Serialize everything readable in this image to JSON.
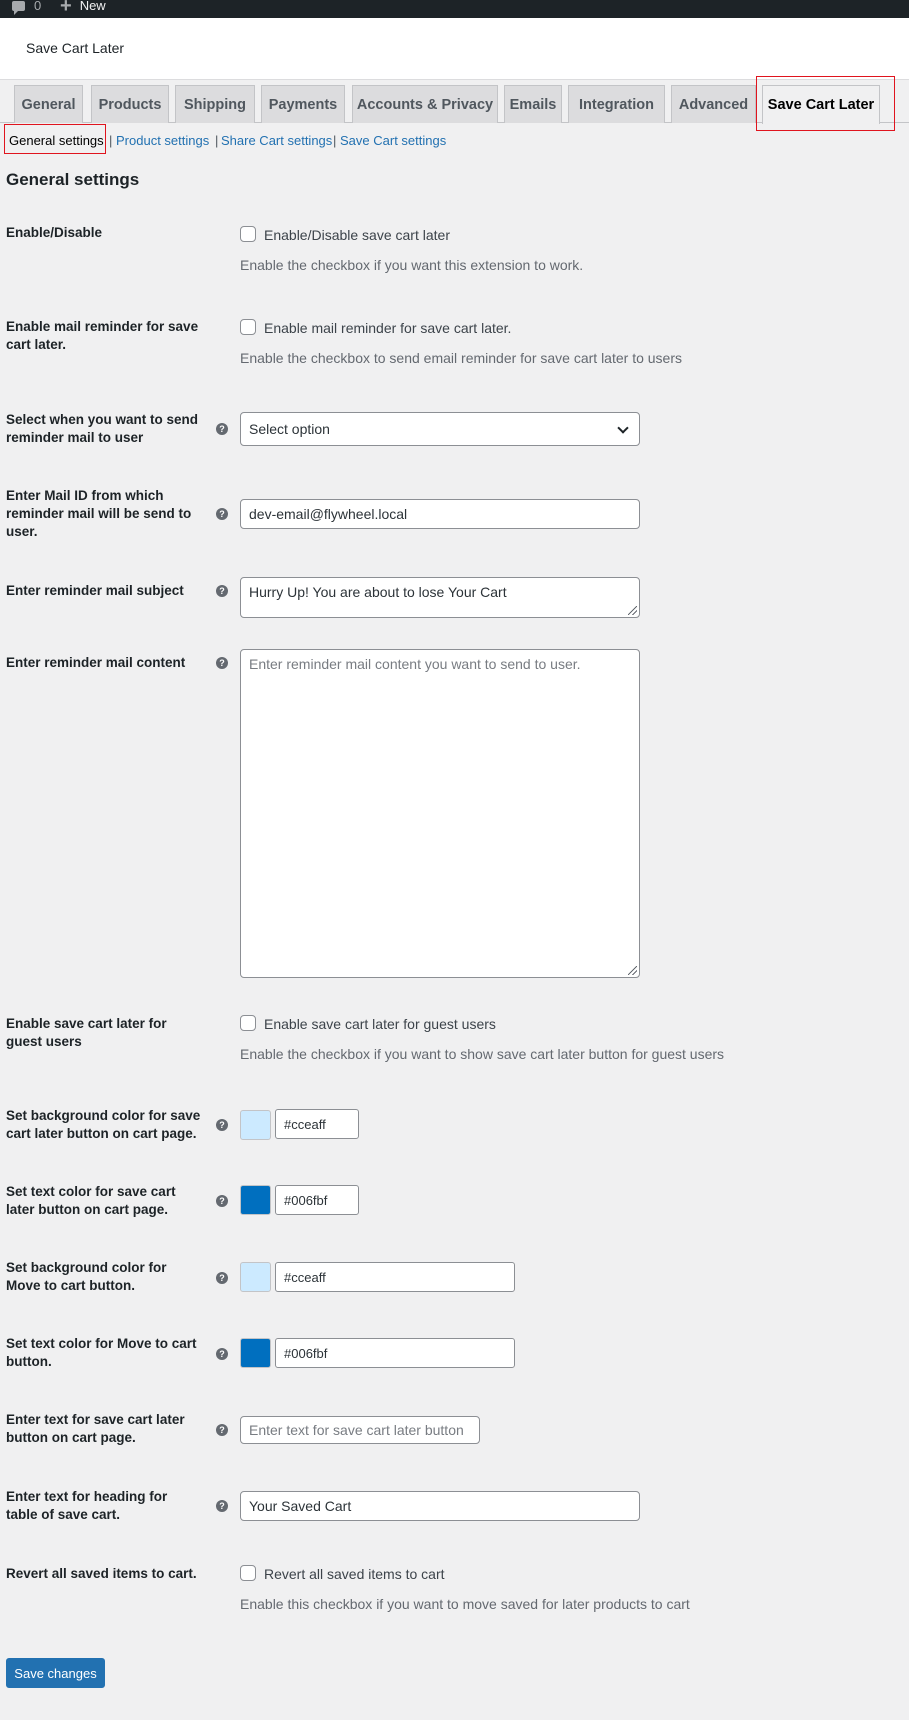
{
  "adminbar": {
    "comments_count": "0",
    "new_label": "New"
  },
  "page_title": "Save Cart Later",
  "tabs": [
    "General",
    "Products",
    "Shipping",
    "Payments",
    "Accounts & Privacy",
    "Emails",
    "Integration",
    "Advanced",
    "Save Cart Later"
  ],
  "active_tab": "Save Cart Later",
  "subnav": {
    "current": "General settings",
    "links": [
      "Product settings",
      "Share Cart settings",
      "Save Cart settings"
    ],
    "separator": "|"
  },
  "section_title": "General settings",
  "settings": {
    "enable": {
      "label": "Enable/Disable",
      "checkbox_label": "Enable/Disable save cart later",
      "description": "Enable the checkbox if you want this extension to work.",
      "checked": false
    },
    "mail_reminder": {
      "label": "Enable mail reminder for save cart later.",
      "checkbox_label": "Enable mail reminder for save cart later.",
      "description": "Enable the checkbox to send email reminder for save cart later to users",
      "checked": false
    },
    "reminder_when": {
      "label": "Select when you want to send reminder mail to user",
      "selected": "Select option"
    },
    "mail_from": {
      "label": "Enter Mail ID from which reminder mail will be send to user.",
      "value": "dev-email@flywheel.local"
    },
    "mail_subject": {
      "label": "Enter reminder mail subject",
      "value": "Hurry Up! You are about to lose Your Cart"
    },
    "mail_content": {
      "label": "Enter reminder mail content",
      "placeholder": "Enter reminder mail content you want to send to user."
    },
    "guest_users": {
      "label": "Enable save cart later for guest users",
      "checkbox_label": "Enable save cart later for guest users",
      "description": "Enable the checkbox if you want to show save cart later button for guest users",
      "checked": false
    },
    "save_btn_bg": {
      "label": "Set background color for save cart later button on cart page.",
      "value": "#cceaff"
    },
    "save_btn_text": {
      "label": "Set text color for save cart later button on cart page.",
      "value": "#006fbf"
    },
    "move_btn_bg": {
      "label": "Set background color for Move to cart button.",
      "value": "#cceaff"
    },
    "move_btn_text": {
      "label": "Set text color for Move to cart button.",
      "value": "#006fbf"
    },
    "save_btn_label": {
      "label": "Enter text for save cart later button on cart page.",
      "placeholder": "Enter text for save cart later button"
    },
    "table_heading": {
      "label": "Enter text for heading for table of save cart.",
      "value": "Your Saved Cart"
    },
    "revert": {
      "label": "Revert all saved items to cart.",
      "checkbox_label": "Revert all saved items to cart",
      "description": "Enable this checkbox if you want to move saved for later products to cart",
      "checked": false
    }
  },
  "save_button": "Save changes",
  "colors": {
    "accent": "#2271b1",
    "highlight_box": "#e0141e",
    "adminbar": "#1d2327"
  }
}
